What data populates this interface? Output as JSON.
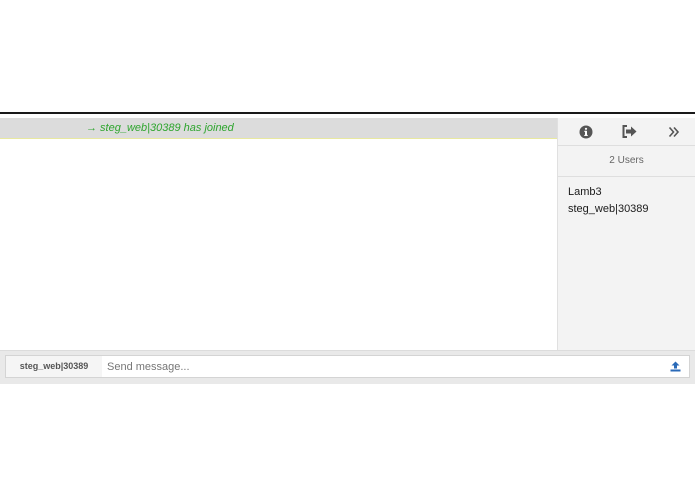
{
  "channel": {
    "join_message": "→ steg_web|30389 has joined"
  },
  "sidebar": {
    "toolbar": {
      "info_icon": "info-circle-icon",
      "leave_icon": "sign-out-icon",
      "collapse_icon": "double-chevron-right-icon"
    },
    "user_count": "2 Users",
    "users": [
      {
        "name": "Lamb3"
      },
      {
        "name": "steg_web|30389"
      }
    ]
  },
  "input": {
    "nick": "steg_web|30389",
    "placeholder": "Send message...",
    "value": "",
    "upload_icon": "upload-icon"
  },
  "colors": {
    "join_text": "#2ea52e",
    "accent_icon": "#2a6ab8",
    "icon_dark": "#555555"
  }
}
